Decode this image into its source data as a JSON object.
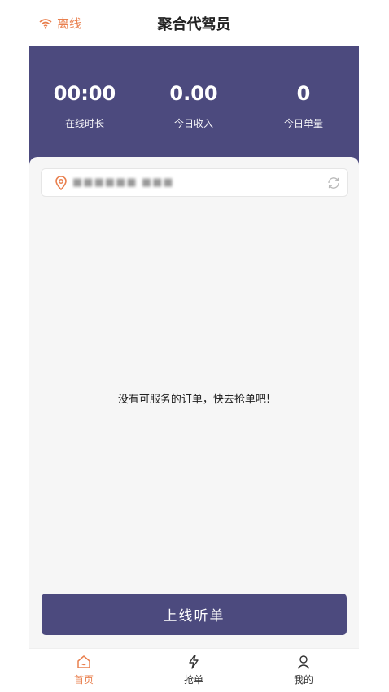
{
  "header": {
    "status_text": "离线",
    "title": "聚合代驾员"
  },
  "stats": [
    {
      "value": "00:00",
      "label": "在线时长"
    },
    {
      "value": "0.00",
      "label": "今日收入"
    },
    {
      "value": "0",
      "label": "今日单量"
    }
  ],
  "location": {
    "text": "■■■■■■ ■■■"
  },
  "empty_message": "没有可服务的订单，快去抢单吧!",
  "online_button": "上线听单",
  "tabs": [
    {
      "label": "首页",
      "icon": "home-icon",
      "active": true
    },
    {
      "label": "抢单",
      "icon": "lightning-icon",
      "active": false
    },
    {
      "label": "我的",
      "icon": "user-icon",
      "active": false
    }
  ],
  "colors": {
    "primary": "#4c4a7e",
    "accent": "#e9804f",
    "background": "#f6f6f6"
  }
}
